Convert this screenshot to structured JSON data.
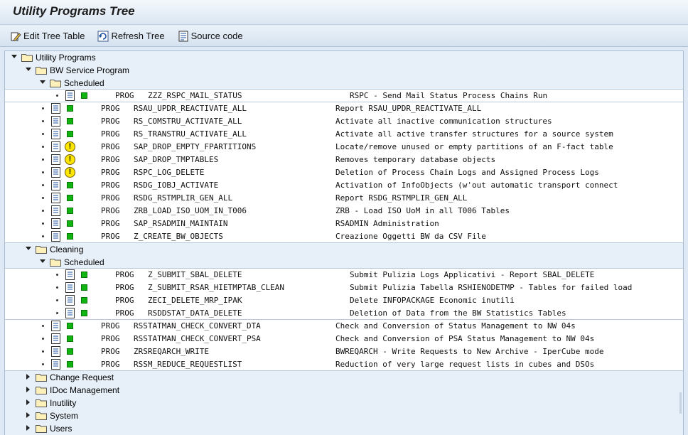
{
  "title": "Utility Programs Tree",
  "toolbar": {
    "edit_label": "Edit Tree Table",
    "refresh_label": "Refresh Tree",
    "source_label": "Source code"
  },
  "tree": {
    "root_label": "Utility Programs",
    "bw_service": {
      "label": "BW Service Program",
      "scheduled_label": "Scheduled",
      "scheduled_items": [
        {
          "type": "PROG",
          "name": "ZZZ_RSPC_MAIL_STATUS",
          "desc": "RSPC - Send Mail Status Process Chains Run",
          "status": "ok"
        }
      ],
      "items": [
        {
          "type": "PROG",
          "name": "RSAU_UPDR_REACTIVATE_ALL",
          "desc": "Report RSAU_UPDR_REACTIVATE_ALL",
          "status": "ok"
        },
        {
          "type": "PROG",
          "name": "RS_COMSTRU_ACTIVATE_ALL",
          "desc": "Activate all inactive communication structures",
          "status": "ok"
        },
        {
          "type": "PROG",
          "name": "RS_TRANSTRU_ACTIVATE_ALL",
          "desc": "Activate all active transfer structures for a source system",
          "status": "ok"
        },
        {
          "type": "PROG",
          "name": "SAP_DROP_EMPTY_FPARTITIONS",
          "desc": "Locate/remove unused or empty partitions of an F-fact table",
          "status": "warn"
        },
        {
          "type": "PROG",
          "name": "SAP_DROP_TMPTABLES",
          "desc": "Removes temporary database objects",
          "status": "warn"
        },
        {
          "type": "PROG",
          "name": "RSPC_LOG_DELETE",
          "desc": "Deletion of Process Chain Logs and Assigned Process Logs",
          "status": "warn"
        },
        {
          "type": "PROG",
          "name": "RSDG_IOBJ_ACTIVATE",
          "desc": "Activation of InfoObjects (w'out automatic transport connect",
          "status": "ok"
        },
        {
          "type": "PROG",
          "name": "RSDG_RSTMPLIR_GEN_ALL",
          "desc": "Report RSDG_RSTMPLIR_GEN_ALL",
          "status": "ok"
        },
        {
          "type": "PROG",
          "name": "ZRB_LOAD_ISO_UOM_IN_T006",
          "desc": "ZRB - Load ISO UoM in all T006 Tables",
          "status": "ok"
        },
        {
          "type": "PROG",
          "name": "SAP_RSADMIN_MAINTAIN",
          "desc": "RSADMIN Administration",
          "status": "ok"
        },
        {
          "type": "PROG",
          "name": "Z_CREATE_BW_OBJECTS",
          "desc": "Creazione Oggetti BW da CSV File",
          "status": "ok"
        }
      ]
    },
    "cleaning": {
      "label": "Cleaning",
      "scheduled_label": "Scheduled",
      "scheduled_items": [
        {
          "type": "PROG",
          "name": "Z_SUBMIT_SBAL_DELETE",
          "desc": "Submit Pulizia Logs Applicativi - Report SBAL_DELETE",
          "status": "ok"
        },
        {
          "type": "PROG",
          "name": "Z_SUBMIT_RSAR_HIETMPTAB_CLEAN",
          "desc": "Submit Pulizia Tabella RSHIENODETMP - Tables for failed load",
          "status": "ok"
        },
        {
          "type": "PROG",
          "name": "ZECI_DELETE_MRP_IPAK",
          "desc": "Delete INFOPACKAGE Economic inutili",
          "status": "ok"
        },
        {
          "type": "PROG",
          "name": "RSDDSTAT_DATA_DELETE",
          "desc": "Deletion of Data from the BW Statistics Tables",
          "status": "ok"
        }
      ],
      "items": [
        {
          "type": "PROG",
          "name": "RSSTATMAN_CHECK_CONVERT_DTA",
          "desc": "Check and Conversion of Status Management to NW 04s",
          "status": "ok"
        },
        {
          "type": "PROG",
          "name": "RSSTATMAN_CHECK_CONVERT_PSA",
          "desc": "Check and Conversion of PSA Status Management to NW 04s",
          "status": "ok"
        },
        {
          "type": "PROG",
          "name": "ZRSREQARCH_WRITE",
          "desc": "BWREQARCH - Write Requests to New Archive - IperCube mode",
          "status": "ok"
        },
        {
          "type": "PROG",
          "name": "RSSM_REDUCE_REQUESTLIST",
          "desc": "Reduction of very large request lists in cubes and DSOs",
          "status": "ok"
        }
      ]
    },
    "collapsed_folders": [
      "Change Request",
      "IDoc Management",
      "Inutility",
      "System",
      "Users"
    ]
  },
  "icons": {
    "edit": "edit-pencil-icon",
    "refresh": "refresh-icon",
    "source": "source-code-icon",
    "folder": "folder-icon",
    "program": "program-document-icon",
    "status_ok": "green-status-icon",
    "status_warn": "warning-exclamation-icon"
  },
  "colors": {
    "status_ok": "#11b311",
    "status_warn": "#ffe600",
    "folder_fill": "#fbe79a",
    "tree_bg": "#e7eff8"
  }
}
